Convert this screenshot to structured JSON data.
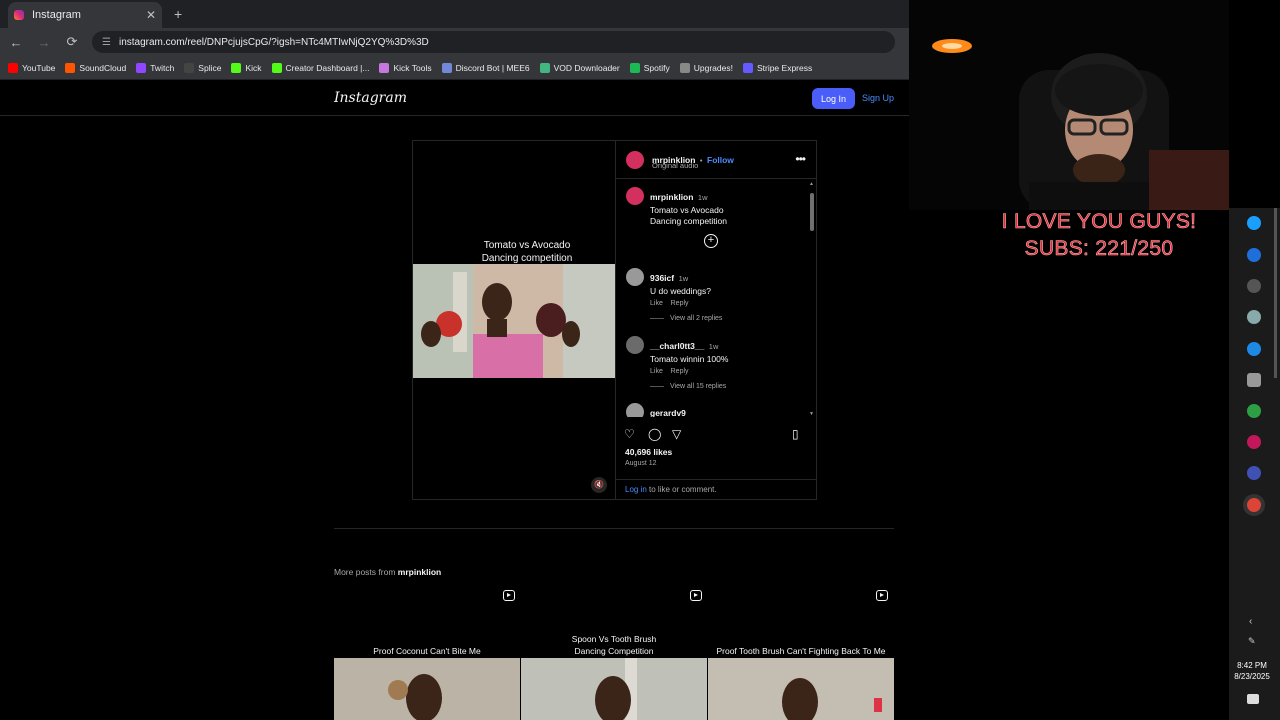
{
  "browser": {
    "tab_title": "Instagram",
    "tab_close": "✕",
    "new_tab": "+",
    "url": "instagram.com/reel/DNPcjujsCpG/?igsh=NTc4MTIwNjQ2YQ%3D%3D",
    "back": "←",
    "forward": "→",
    "reload": "⟳",
    "bookmarks": [
      {
        "label": "YouTube",
        "color": "#ff0000"
      },
      {
        "label": "SoundCloud",
        "color": "#ff5500"
      },
      {
        "label": "Twitch",
        "color": "#9146ff"
      },
      {
        "label": "Splice",
        "color": "#444444"
      },
      {
        "label": "Kick",
        "color": "#53fc18"
      },
      {
        "label": "Creator Dashboard |...",
        "color": "#53fc18"
      },
      {
        "label": "Kick Tools",
        "color": "#c678dd"
      },
      {
        "label": "Discord Bot | MEE6",
        "color": "#7289da"
      },
      {
        "label": "VOD Downloader",
        "color": "#43b581"
      },
      {
        "label": "Spotify",
        "color": "#1db954"
      },
      {
        "label": "Upgrades!",
        "color": "#888888"
      },
      {
        "label": "Stripe Express",
        "color": "#635bff"
      }
    ]
  },
  "instagram": {
    "logo": "Instagram",
    "login_button": "Log In",
    "signup_button": "Sign Up",
    "post": {
      "reel_title": "Tomato vs Avocado\nDancing competition",
      "username": "mrpinklion",
      "separator": "•",
      "follow": "Follow",
      "audio": "Original audio",
      "more": "•••",
      "caption": {
        "user": "mrpinklion",
        "time": "1w",
        "text": "Tomato vs Avocado\nDancing competition"
      },
      "comments": [
        {
          "user": "936icf",
          "time": "1w",
          "text": "U do weddings?",
          "like": "Like",
          "reply": "Reply",
          "view_replies": "View all 2 replies"
        },
        {
          "user": "__charl0tt3__",
          "time": "1w",
          "text": "Tomato winnin 100%",
          "like": "Like",
          "reply": "Reply",
          "view_replies": "View all 15 replies"
        },
        {
          "user": "gerardv9",
          "time": "",
          "text": "",
          "like": "",
          "reply": "",
          "view_replies": ""
        }
      ],
      "likes": "40,696 likes",
      "date": "August 12",
      "login_link": "Log in",
      "login_suffix": " to like or comment."
    },
    "more_posts_prefix": "More posts from ",
    "more_posts_user": "mrpinklion",
    "more_posts": [
      {
        "title": "Proof Coconut Can't Bite Me"
      },
      {
        "title": "Spoon Vs Tooth Brush\nDancing Competition"
      },
      {
        "title": "Proof Tooth Brush Can't Fighting Back To Me"
      }
    ]
  },
  "stream": {
    "overlay_line1": "I LOVE YOU GUYS!",
    "overlay_line2": "SUBS: 221/250",
    "clock_time": "8:42 PM",
    "clock_date": "8/23/2025"
  }
}
